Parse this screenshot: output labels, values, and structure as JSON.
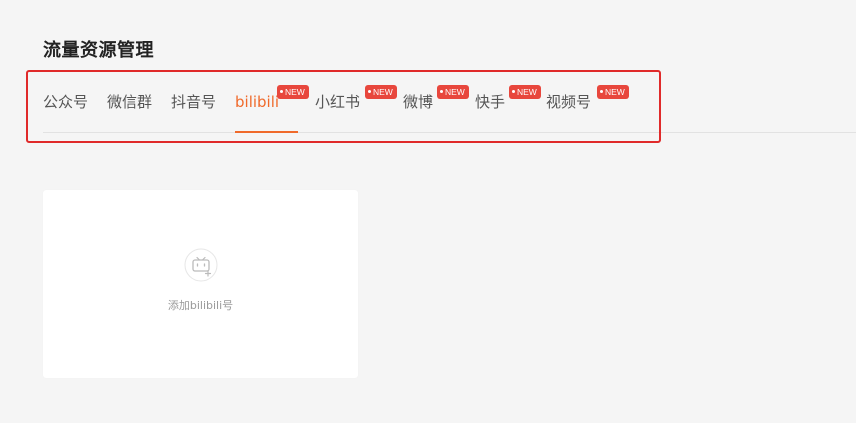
{
  "page": {
    "title": "流量资源管理"
  },
  "tabs": [
    {
      "label": "公众号",
      "new": false,
      "active": false
    },
    {
      "label": "微信群",
      "new": false,
      "active": false
    },
    {
      "label": "抖音号",
      "new": false,
      "active": false
    },
    {
      "label": "bilibili",
      "new": true,
      "active": true,
      "badge": "NEW"
    },
    {
      "label": "小红书",
      "new": true,
      "active": false,
      "badge": "NEW"
    },
    {
      "label": "微博",
      "new": true,
      "active": false,
      "badge": "NEW"
    },
    {
      "label": "快手",
      "new": true,
      "active": false,
      "badge": "NEW"
    },
    {
      "label": "视频号",
      "new": true,
      "active": false,
      "badge": "NEW"
    }
  ],
  "add_card": {
    "label": "添加bilibili号",
    "icon": "bilibili-tv-add-icon"
  },
  "colors": {
    "accent": "#f06a2b",
    "badge": "#e8473d",
    "highlight_border": "#e02a2a",
    "background": "#f5f5f5"
  }
}
